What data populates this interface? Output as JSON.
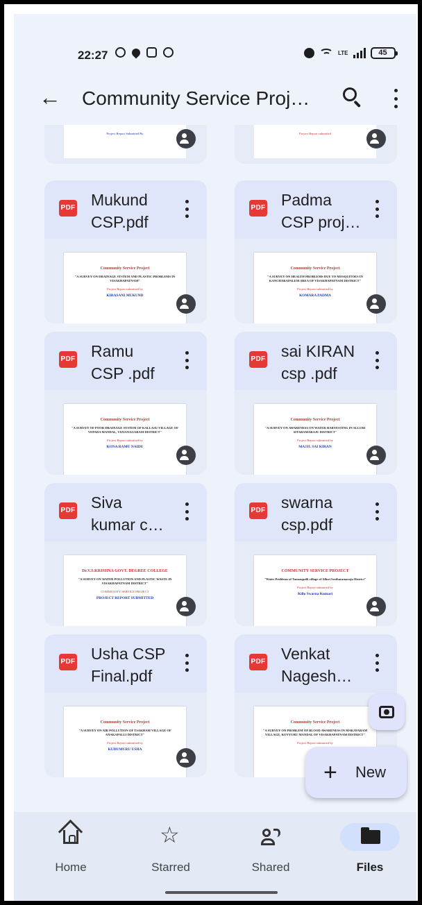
{
  "status": {
    "time": "22:27",
    "battery": "45",
    "network": "LTE"
  },
  "appbar": {
    "back_icon": "arrow-left-icon",
    "title": "Community Service Proj…"
  },
  "partial_top": [
    {
      "caption": "Project Report Submitted By"
    },
    {
      "caption": "Project Report submitted"
    }
  ],
  "files": [
    {
      "name": "Mukund\nCSP.pdf",
      "thumb_title": "Community Service Project",
      "thumb_text": "\"A SURVEY ON DRAINAGE SYSTEM AND PLASTIC PROBLEMS IN VISAKHAPATNAM\"",
      "thumb_sub": "Project Report submitted by",
      "thumb_author": "KIRASANI MUKUND"
    },
    {
      "name": "Padma\nCSP proj…",
      "thumb_title": "Community Service Project",
      "thumb_text": "\"A SURVEY ON HEALTH PROBLEMS DUE TO MOSQUITOES IN KANCHARAPALEM AREA OF VISAKHAPATNAM DISTRICT\"",
      "thumb_sub": "Project Report submitted by",
      "thumb_author": "KOMARA PADMA"
    },
    {
      "name": "Ramu\nCSP .pdf",
      "thumb_title": "Community Service Project",
      "thumb_text": "\"A SURVEY OF POOR DRAINAGE SYSTEM OF KALLASU VILLAGE OF VEPADA MANDAL, VIZIANAGARAM DISTRICT\"",
      "thumb_sub": "Project Report submitted by",
      "thumb_author": "KONA RAMU NAIDU"
    },
    {
      "name": "sai KIRAN\ncsp .pdf",
      "thumb_title": "Community Service Project",
      "thumb_text": "\"A SURVEY ON AWARENESS ON WATER HARVESTING IN ALLURI SITARAMARAJU DISTRICT\"",
      "thumb_sub": "Project Report submitted by",
      "thumb_author": "MAJJI. SAI KIRAN"
    },
    {
      "name": "Siva\nkumar c…",
      "thumb_title": "Dr.V.S.KRISHNA GOVT. DEGREE COLLEGE",
      "thumb_text": "\"A SURVEY ON WATER POLLUTION AND PLASTIC WASTE IN VISAKHAPATNAM DISTRICT\"",
      "thumb_sub": "COMMUNITY SERVICE PROJECT",
      "thumb_author": "PROJECT REPORT SUBMITTED"
    },
    {
      "name": "swarna\ncsp.pdf",
      "thumb_title": "COMMUNITY SERVICE PROJECT",
      "thumb_text": "\"Water Problems of Tanuzupalli village of Alluri Seetharamaraju District\"",
      "thumb_sub": "Project Report submitted by",
      "thumb_author": "Killo Swarna Kumari"
    },
    {
      "name": "Usha CSP\nFinal.pdf",
      "thumb_title": "Community Service Project",
      "thumb_text": "\"A SURVEY ON AIR POLLUTION OF TSAKHAM VILLAGE OF ANAKAPALLI DISTRICT\"",
      "thumb_sub": "Project Report submitted by",
      "thumb_author": "KUDUMURU USHA"
    },
    {
      "name": "Venkat\nNagesh…",
      "thumb_title": "Community Service Project",
      "thumb_text": "\"A SURVEY ON PROBLEM OF BLOOD AWARENESS IN MAKAVARAM VILLAGE, KOYYURU MANDAL OF VISAKHAPATNAM DISTRICT\"",
      "thumb_sub": "Project Report submitted by",
      "thumb_author": ""
    }
  ],
  "file_badge": "PDF",
  "fab": {
    "camera_icon": "camera-icon",
    "new_label": "New",
    "new_icon": "plus-icon"
  },
  "nav": [
    {
      "label": "Home",
      "icon": "home-icon"
    },
    {
      "label": "Starred",
      "icon": "star-icon"
    },
    {
      "label": "Shared",
      "icon": "shared-people-icon"
    },
    {
      "label": "Files",
      "icon": "folder-icon",
      "active": true
    }
  ],
  "colors": {
    "pdf_badge": "#e53935",
    "card_bg": "#dfe6f9",
    "screen_bg": "#eef2fb",
    "nav_bg": "#e4e9f6",
    "active_pill": "#d3e0fb"
  }
}
